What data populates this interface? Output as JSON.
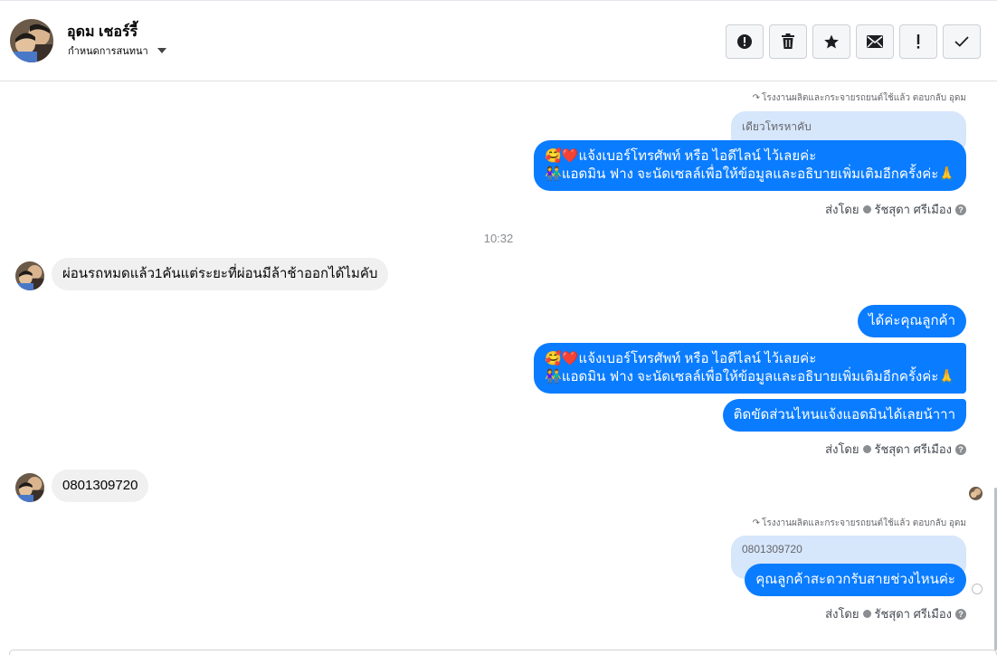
{
  "header": {
    "contact_name": "อุดม เชอร์รี้",
    "conversation_settings_label": "กำหนดการสนทนา",
    "actions": [
      {
        "name": "mark-spam-button",
        "icon": "alert-circle-icon"
      },
      {
        "name": "delete-button",
        "icon": "trash-icon"
      },
      {
        "name": "star-button",
        "icon": "star-icon"
      },
      {
        "name": "mark-unread-button",
        "icon": "envelope-icon"
      },
      {
        "name": "follow-up-button",
        "icon": "exclamation-icon"
      },
      {
        "name": "mark-done-button",
        "icon": "check-icon"
      }
    ]
  },
  "thread": {
    "replies": [
      {
        "meta": "โรงงานผลิตและกระจายรถยนต์ใช้แล้ว ตอบกลับ อุดม",
        "quote": "เดียวโทรหาคับ",
        "message_line1": "🥰❤️แจ้งเบอร์โทรศัพท์ หรือ ไอดีไลน์  ไว้เลยค่ะ",
        "message_line2": "👫แอดมิน ฟาง จะนัดเซลล์เพื่อให้ข้อมูลและอธิบายเพิ่มเติมอีกครั้งค่ะ🙏"
      },
      {
        "meta": "โรงงานผลิตและกระจายรถยนต์ใช้แล้ว ตอบกลับ อุดม",
        "quote": "0801309720",
        "message": "คุณลูกค้าสะดวกรับสายช่วงไหนค่ะ"
      }
    ],
    "sent_by_label": "ส่งโดย",
    "sent_by_name": "รัชสุดา ศรีเมือง",
    "timestamp": "10:32",
    "incoming_1": "ผ่อนรถหมดแล้ว1คันแต่ระยะที่ผ่อนมีล้าช้าออกได้ไมคับ",
    "outgoing_group": {
      "msg1": "ได้ค่ะคุณลูกค้า",
      "msg2_line1": "🥰❤️แจ้งเบอร์โทรศัพท์ หรือ ไอดีไลน์  ไว้เลยค่ะ",
      "msg2_line2": "👫แอดมิน ฟาง จะนัดเซลล์เพื่อให้ข้อมูลและอธิบายเพิ่มเติมอีกครั้งค่ะ🙏",
      "msg3": "ติดขัดส่วนไหนแจ้งแอดมินได้เลยน้าาา"
    },
    "incoming_2": "0801309720"
  },
  "colors": {
    "outgoing_bubble": "#0a7cff",
    "incoming_bubble": "#f0f0f0",
    "quote_bubble": "#d6e6fb"
  }
}
